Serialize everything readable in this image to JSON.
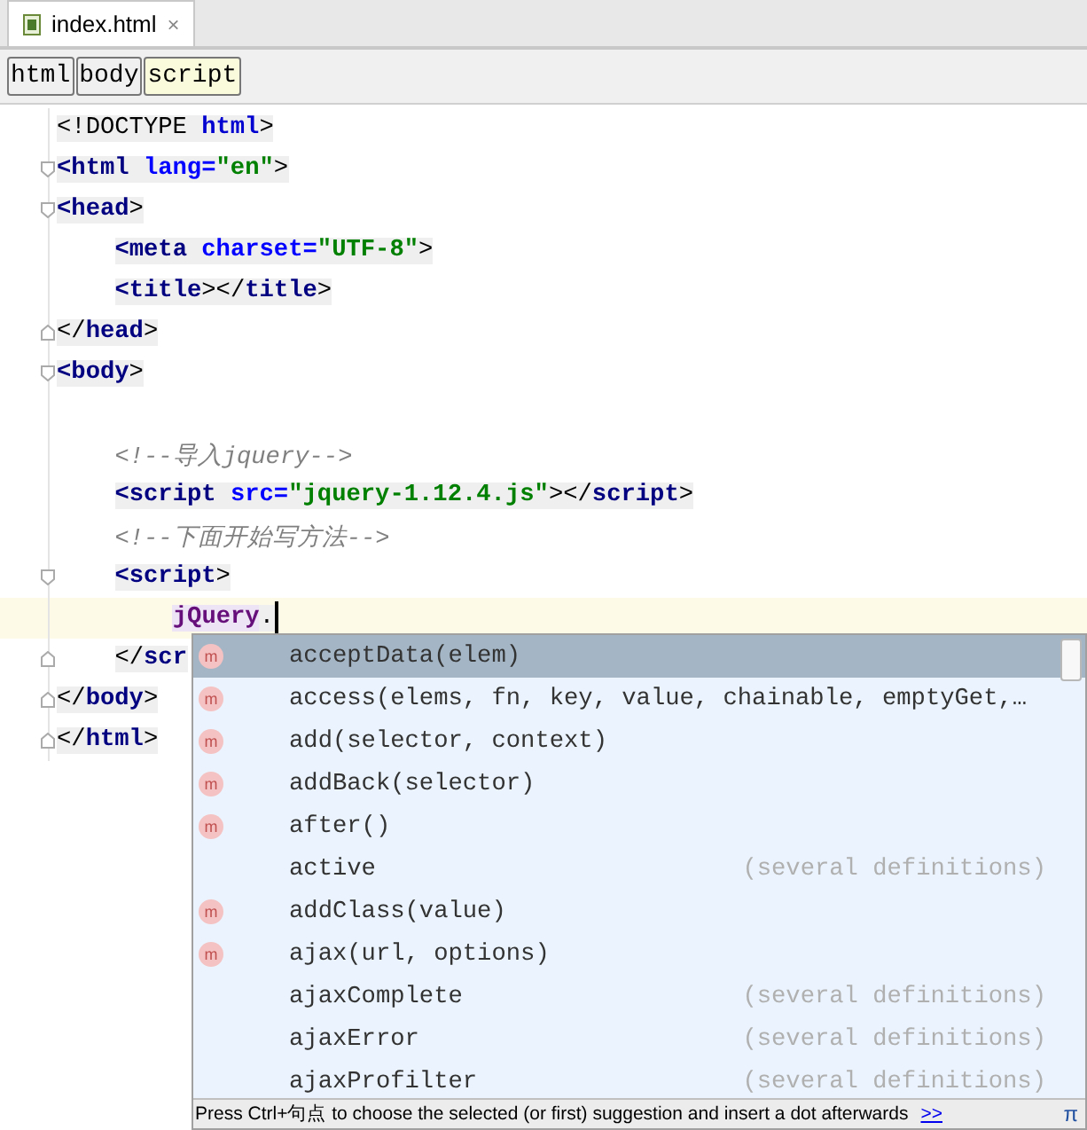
{
  "tabs": [
    {
      "label": "index.html",
      "close": "×",
      "selected": true
    }
  ],
  "breadcrumbs": [
    {
      "label": "html",
      "selected": false
    },
    {
      "label": "body",
      "selected": false
    },
    {
      "label": "script",
      "selected": true
    }
  ],
  "editor": {
    "lines": [
      {
        "tokens": [
          {
            "kind": "text",
            "text": "<!DOCTYPE "
          },
          {
            "kind": "keyword",
            "text": "html"
          },
          {
            "kind": "text",
            "text": ">"
          }
        ]
      },
      {
        "fold_start": true,
        "tokens": [
          {
            "kind": "tag",
            "text": "<html "
          },
          {
            "kind": "attr",
            "text": "lang="
          },
          {
            "kind": "string",
            "text": "\"en\""
          },
          {
            "kind": "text",
            "text": ">"
          }
        ]
      },
      {
        "fold_start": true,
        "tokens": [
          {
            "kind": "tag",
            "text": "<head"
          },
          {
            "kind": "text",
            "text": ">"
          }
        ],
        "children": [
          {
            "tokens": [
              {
                "kind": "tag",
                "text": "<meta "
              },
              {
                "kind": "attr",
                "text": "charset="
              },
              {
                "kind": "string",
                "text": "\"UTF-8\""
              },
              {
                "kind": "text",
                "text": ">"
              }
            ]
          },
          {
            "tokens": [
              {
                "kind": "tag",
                "text": "<title"
              },
              {
                "kind": "text",
                "text": "></"
              },
              {
                "kind": "tag",
                "text": "title"
              },
              {
                "kind": "text",
                "text": ">"
              }
            ]
          }
        ]
      },
      {
        "fold_end": true,
        "tokens": [
          {
            "kind": "text",
            "text": "</"
          },
          {
            "kind": "tag",
            "text": "head"
          },
          {
            "kind": "text",
            "text": ">"
          }
        ]
      },
      {
        "fold_start": true,
        "tokens": [
          {
            "kind": "tag",
            "text": "<body"
          },
          {
            "kind": "text",
            "text": ">"
          }
        ],
        "children": [
          {
            "blank": true
          },
          {
            "tokens": [
              {
                "kind": "comment",
                "text": "<!--导入jquery-->"
              }
            ]
          },
          {
            "tokens": [
              {
                "kind": "tag",
                "text": "<script "
              },
              {
                "kind": "attr",
                "text": "src="
              },
              {
                "kind": "string",
                "text": "\"jquery-1.12.4.js\""
              },
              {
                "kind": "text",
                "text": "></"
              },
              {
                "kind": "tag",
                "text": "script"
              },
              {
                "kind": "text",
                "text": ">"
              }
            ]
          },
          {
            "tokens": [
              {
                "kind": "comment",
                "text": "<!--下面开始写方法-->"
              }
            ]
          },
          {
            "fold_start": true,
            "tokens": [
              {
                "kind": "tag",
                "text": "<script"
              },
              {
                "kind": "text",
                "text": ">"
              }
            ],
            "children": [
              {
                "current": true,
                "caret": true,
                "tokens": [
                  {
                    "kind": "identifier",
                    "text": "jQuery"
                  },
                  {
                    "kind": "text",
                    "text": "."
                  }
                ]
              }
            ]
          },
          {
            "fold_end": true,
            "tokens": [
              {
                "kind": "text",
                "text": "</"
              },
              {
                "kind": "tag",
                "text": "scr"
              }
            ]
          }
        ]
      },
      {
        "fold_end": true,
        "tokens": [
          {
            "kind": "text",
            "text": "</"
          },
          {
            "kind": "tag",
            "text": "body"
          },
          {
            "kind": "text",
            "text": ">"
          }
        ]
      },
      {
        "fold_end": true,
        "tokens": [
          {
            "kind": "text",
            "text": "</"
          },
          {
            "kind": "tag",
            "text": "html"
          },
          {
            "kind": "text",
            "text": ">"
          }
        ]
      }
    ]
  },
  "completion": {
    "items": [
      {
        "icon": "m",
        "name": "acceptData",
        "params": "(elem)",
        "selected": true
      },
      {
        "icon": "m",
        "name": "access",
        "params": "(elems, fn, key, value, chainable, emptyGet,…",
        "selected": false
      },
      {
        "icon": "m",
        "name": "add",
        "params": "(selector, context)",
        "selected": false
      },
      {
        "icon": "m",
        "name": "addBack",
        "params": "(selector)",
        "selected": false
      },
      {
        "icon": "m",
        "name": "after",
        "params": "()",
        "selected": false
      },
      {
        "name": "active",
        "note": "(several definitions)",
        "selected": false
      },
      {
        "icon": "m",
        "name": "addClass",
        "params": "(value)",
        "selected": false
      },
      {
        "icon": "m",
        "name": "ajax",
        "params": "(url, options)",
        "selected": false
      },
      {
        "name": "ajaxComplete",
        "note": "(several definitions)",
        "selected": false
      },
      {
        "name": "ajaxError",
        "note": "(several definitions)",
        "selected": false
      },
      {
        "name": "ajaxProfilter",
        "note": "(several definitions)",
        "selected": false
      }
    ],
    "hint": "Press Ctrl+句点 to choose the selected (or first) suggestion and insert a dot afterwards",
    "hint_link": ">>",
    "pi": "π"
  }
}
